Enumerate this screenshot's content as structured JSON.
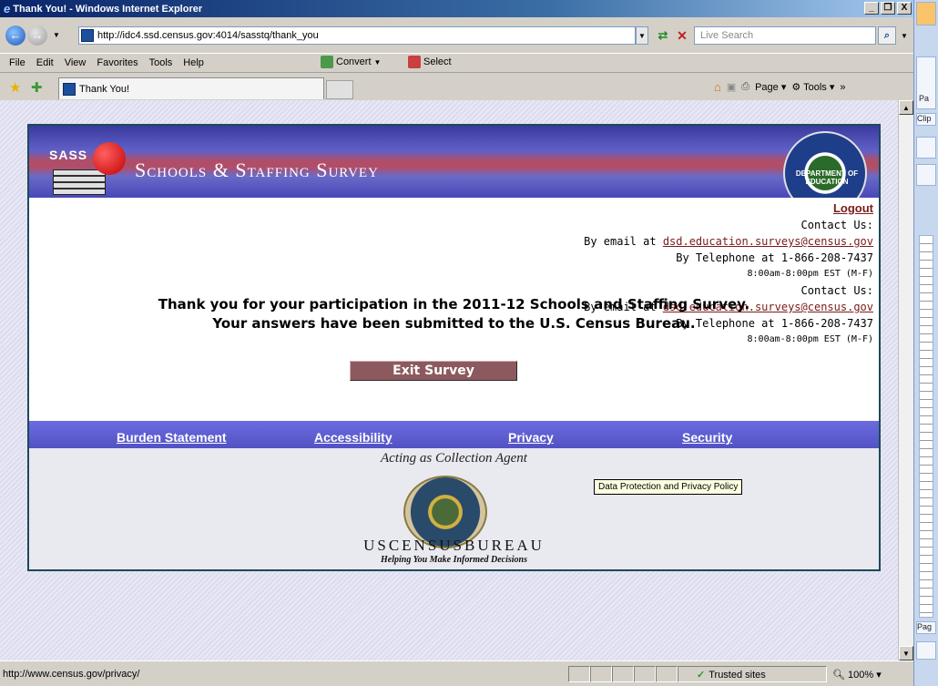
{
  "window": {
    "title": "Thank You! - Windows Internet Explorer",
    "buttons": [
      "_",
      "Θ",
      "X"
    ]
  },
  "address": {
    "url": "http://idc4.ssd.census.gov:4014/sasstq/thank_you",
    "search_placeholder": "Live Search"
  },
  "menu": {
    "items": [
      "File",
      "Edit",
      "View",
      "Favorites",
      "Tools",
      "Help"
    ],
    "convert_label": "Convert",
    "select_label": "Select"
  },
  "favbar": {
    "tab_title": "Thank You!",
    "page_label": "Page",
    "tools_label": "Tools"
  },
  "banner": {
    "sass": "SASS",
    "title": "Schools & Staffing Survey",
    "seal_text": "DEPARTMENT OF EDUCATION"
  },
  "contact": {
    "logout": "Logout",
    "contact_us": "Contact Us:",
    "email_prefix": "By email at",
    "email": "dsd.education.surveys@census.gov",
    "telephone": "By Telephone at 1-866-208-7437",
    "hours": "8:00am-8:00pm EST (M-F)"
  },
  "main": {
    "thanks_line1": "Thank you for your participation in the 2011-12 Schools and Staffing Survey.",
    "thanks_line2": "Your answers have been submitted to the U.S. Census Bureau.",
    "exit_label": "Exit Survey"
  },
  "footer": {
    "links": [
      "Burden Statement",
      "Accessibility",
      "Privacy",
      "Security"
    ],
    "agent": "Acting as Collection Agent",
    "census_name": "USCENSUSBUREAU",
    "census_tag": "Helping You Make Informed Decisions",
    "tooltip": "Data Protection and Privacy Policy"
  },
  "status": {
    "url": "http://www.census.gov/privacy/",
    "zone": "Trusted sites",
    "zoom": "100%"
  },
  "side_panel": {
    "labels": [
      "Pa",
      "Clip",
      "Pag"
    ]
  }
}
